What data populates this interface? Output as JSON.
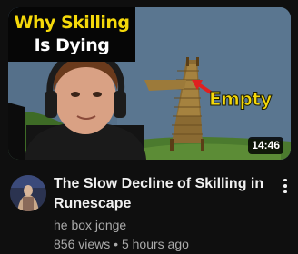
{
  "thumbnail": {
    "title_line1": "Why Skilling",
    "title_line2": "Is Dying",
    "annotation": "Empty",
    "duration": "14:46",
    "text_color": "#f5d90a"
  },
  "video": {
    "title": "The Slow Decline of Skilling in Runescape",
    "channel": "he box jonge",
    "views": "856 views",
    "separator": "•",
    "age": "5 hours ago"
  },
  "icons": {
    "menu": "more-vert-icon",
    "arrow": "arrow-left-icon"
  },
  "colors": {
    "background": "#0f0f0f",
    "title_text": "#f1f1f1",
    "secondary_text": "#aaaaaa",
    "arrow": "#e02020"
  }
}
